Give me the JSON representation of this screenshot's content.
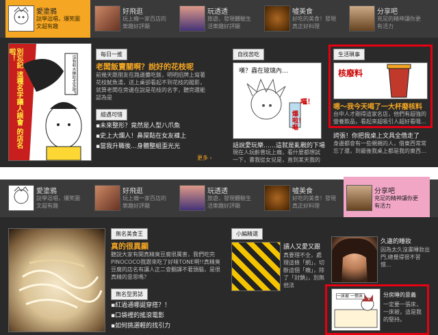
{
  "panel1": {
    "tabs": [
      {
        "title": "愛塗鴉",
        "sub": "說學逗唱，爆笑圖文超有趣"
      },
      {
        "title": "好飛逛",
        "sub": "玩上癮一家百店的樂趣好評顯"
      },
      {
        "title": "玩透透",
        "sub": "旅遊，發現體驗生活樂趣好評顯"
      },
      {
        "title": "噓美食",
        "sub": "好吃的美食！發現真正好料理"
      },
      {
        "title": "分享吧",
        "sub": "充足的精神讓你更有活力"
      }
    ],
    "col1": {
      "comic_text": "別忘記 這種名字讓人誤會 的店名啦！",
      "bubble": "沒有和大佛吃太多吧？",
      "label": "每日一推",
      "title": "老闆飯賣關啊？說好的花枝呢",
      "body": "前幾天跟朋友在路邊攤吃飯，明明招牌上寫著花枝魷魚湯，送上桌卻看起不到花枝的蹤影，就算老闆在旁邊在說是花枝的名字，聽完還能認為是",
      "label2": "繪遇可惜",
      "bullets": [
        "未來整形？竟然是人型八爪魚",
        "史上大爛人！鼻屎黏在女友褲上",
        "當我升職後…身體整組歪光光"
      ],
      "more": "更多 ›"
    },
    "col2": {
      "label": "自找苦吃",
      "bubble1": "嘆？蟲在玻璃內…",
      "bubble2": "嘔！",
      "bubble3": "爆啦！嘔",
      "title": "話說愛玩樂……這就是亂戰的下場",
      "body": "現在人玩齡普玩上癮，看什麼都想試一下，書我從女兒是，直到某天我的"
    },
    "col3": {
      "label": "生活瑣事",
      "img_text": "核廢料",
      "title": "嗯～我今天喝了一大杯廢核料",
      "body": "台中人才剛得這家名店，他們有超強的營養飲品，看起來超吸引人超好看哦…",
      "title2": "誇張！你把我桌上文具全借走了",
      "body2": "身邊都會有一些親親的人，借東西常常忘了還，到最後我桌上都是我的東西…"
    }
  },
  "panel2": {
    "tabs": [
      {
        "title": "愛塗鴉",
        "sub": "說學逗唱，爆笑圖文超有趣"
      },
      {
        "title": "好飛逛",
        "sub": "玩上癮一家百店的樂趣好評顯"
      },
      {
        "title": "玩透透",
        "sub": "旅遊，發現體驗生活樂趣好評顯"
      },
      {
        "title": "噓美食",
        "sub": "好吃的美食！發現真正好料理"
      },
      {
        "title": "分享吧",
        "sub": "充足的精神讓你更有活力"
      }
    ],
    "col1": {
      "label": "無名美食王",
      "title": "真的很異顯",
      "body": "聽說大家有開真精臭豆腐很厲害，我們吃完PINOCOCO我跟來吃了好味TONE啊!!真精臭豆腐的店名有讓人正二會翻譯不著頭腦，是很真精的意思嗎？",
      "label2": "無名型男誌",
      "bullets": [
        "紅過通哪誕穿搭？！",
        "口袋裡的搖滾電影",
        "如何挑選輕的找引力"
      ]
    },
    "col2": {
      "label": "小編精選",
      "title": "讀人又愛又跟",
      "body": "真要理不全，處理這條「網」，切斷這個「癮」，除了「封鎖」，別無他法"
    },
    "col3": {
      "title": "久違的睡妝",
      "body": "因為太久沒畫睡妝出門,總覺得很不習慣…"
    },
    "col4": {
      "title": "分房睡的意義",
      "body": "一定要一張床，一床被，這是我的堅持。",
      "img_text": "一床被 一張床"
    }
  }
}
